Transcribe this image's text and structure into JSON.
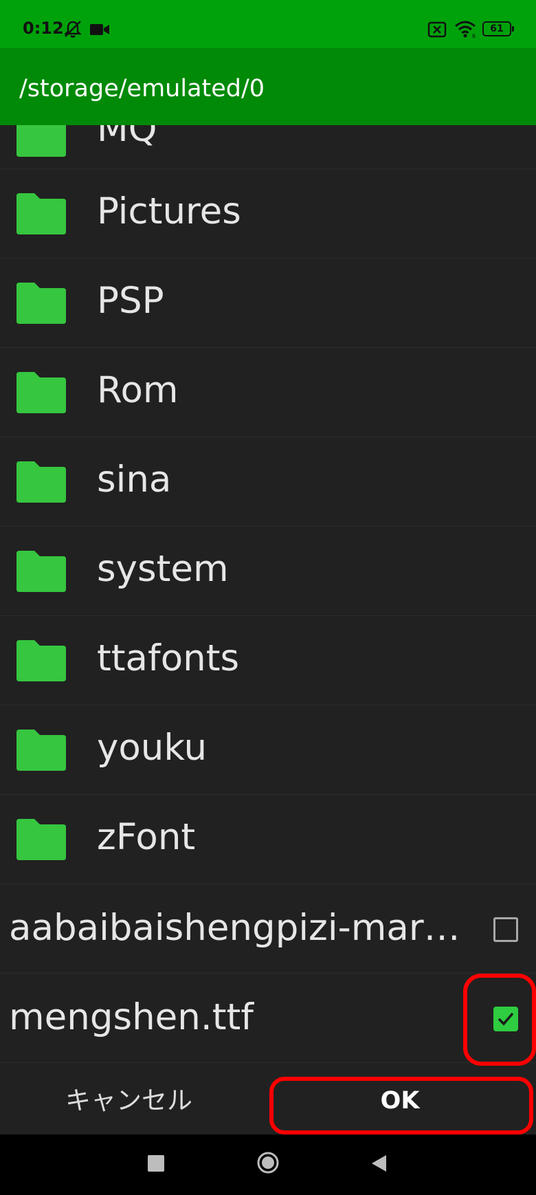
{
  "status_bar": {
    "time": "0:12",
    "battery": "61",
    "icons": [
      "bell-off-icon",
      "video-camera-icon",
      "sim-off-icon",
      "wifi-icon",
      "battery-icon"
    ]
  },
  "header": {
    "path": "/storage/emulated/0"
  },
  "folders": [
    {
      "name": "MQ",
      "icon": "folder-icon"
    },
    {
      "name": "Pictures",
      "icon": "folder-icon"
    },
    {
      "name": "PSP",
      "icon": "folder-icon"
    },
    {
      "name": "Rom",
      "icon": "folder-icon"
    },
    {
      "name": "sina",
      "icon": "folder-icon"
    },
    {
      "name": "system",
      "icon": "folder-icon"
    },
    {
      "name": "ttafonts",
      "icon": "folder-icon"
    },
    {
      "name": "youku",
      "icon": "folder-icon"
    },
    {
      "name": "zFont",
      "icon": "folder-icon"
    }
  ],
  "files": [
    {
      "name": "aabaibaishengpizi-mar…",
      "checked": false
    },
    {
      "name": "mengshen.ttf",
      "checked": true
    }
  ],
  "dialog": {
    "cancel_label": "キャンセル",
    "ok_label": "OK"
  },
  "colors": {
    "status_bar": "#00a20b",
    "title_bar": "#008a08",
    "background": "#212121",
    "folder": "#36c63f",
    "checkbox_checked": "#2ecc40",
    "highlight": "#ff0000"
  },
  "nav_bar": {
    "icons": [
      "recents-icon",
      "home-icon",
      "back-icon"
    ]
  }
}
